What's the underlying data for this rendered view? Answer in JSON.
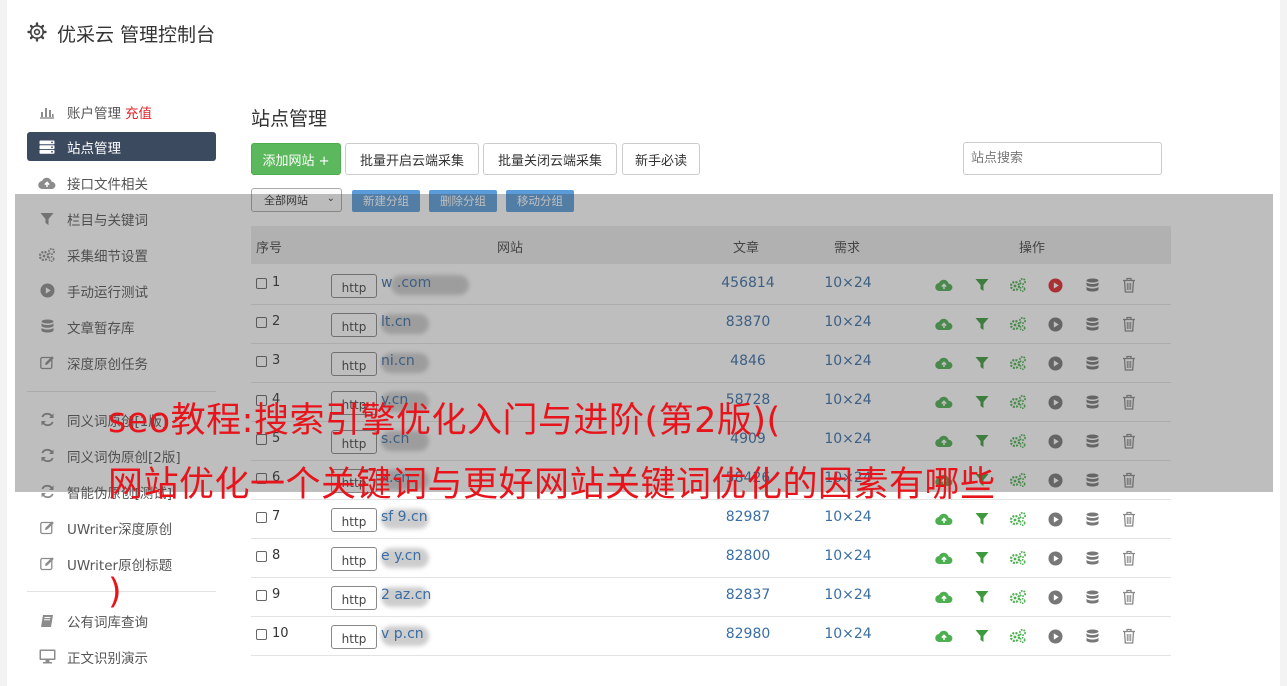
{
  "header": {
    "title": "优采云 管理控制台",
    "icon": "gear-icon"
  },
  "sidebar": {
    "items": [
      {
        "label": "账户管理",
        "extra": "充值",
        "icon": "bar-chart-icon"
      },
      {
        "label": "站点管理",
        "icon": "server-icon",
        "active": true
      },
      {
        "label": "接口文件相关",
        "icon": "cloud-upload-icon"
      },
      {
        "label": "栏目与关键词",
        "icon": "filter-icon"
      },
      {
        "label": "采集细节设置",
        "icon": "cogs-icon"
      },
      {
        "label": "手动运行测试",
        "icon": "play-circle-icon"
      },
      {
        "label": "文章暂存库",
        "icon": "database-icon"
      },
      {
        "label": "深度原创任务",
        "icon": "edit-icon"
      },
      {
        "label": "同义词原创[1版]",
        "icon": "refresh-icon"
      },
      {
        "label": "同义词伪原创[2版]",
        "icon": "refresh-icon"
      },
      {
        "label": "智能伪原创[测试]",
        "icon": "refresh-icon"
      },
      {
        "label": "UWriter深度原创",
        "icon": "edit-icon"
      },
      {
        "label": "UWriter原创标题",
        "icon": "edit-icon"
      },
      {
        "label": "公有词库查询",
        "icon": "book-icon"
      },
      {
        "label": "正文识别演示",
        "icon": "monitor-icon"
      }
    ]
  },
  "main": {
    "title": "站点管理",
    "buttons": {
      "add": "添加网站 +",
      "batch_open": "批量开启云端采集",
      "batch_close": "批量关闭云端采集",
      "guide": "新手必读"
    },
    "search_placeholder": "站点搜索",
    "group_select": "全部网站",
    "group_buttons": {
      "new": "新建分组",
      "delete": "删除分组",
      "move": "移动分组"
    },
    "table": {
      "headers": {
        "index": "序号",
        "site": "网站",
        "articles": "文章",
        "demand": "需求",
        "ops": "操作"
      },
      "http_label": "http",
      "rows": [
        {
          "num": "1",
          "site": "w .com",
          "articles": "456814",
          "demand": "10×24",
          "running": true
        },
        {
          "num": "2",
          "site": "lt.cn",
          "articles": "83870",
          "demand": "10×24",
          "running": false
        },
        {
          "num": "3",
          "site": "ni.cn",
          "articles": "4846",
          "demand": "10×24",
          "running": false
        },
        {
          "num": "4",
          "site": "y.cn",
          "articles": "58728",
          "demand": "10×24",
          "running": false
        },
        {
          "num": "5",
          "site": "s.cn",
          "articles": "4909",
          "demand": "10×24",
          "running": false
        },
        {
          "num": "6",
          "site": "k.cn",
          "articles": "58426",
          "demand": "10×24",
          "running": false
        },
        {
          "num": "7",
          "site": "sf 9.cn",
          "articles": "82987",
          "demand": "10×24",
          "running": false
        },
        {
          "num": "8",
          "site": "e y.cn",
          "articles": "82800",
          "demand": "10×24",
          "running": false
        },
        {
          "num": "9",
          "site": "2 az.cn",
          "articles": "82837",
          "demand": "10×24",
          "running": false
        },
        {
          "num": "10",
          "site": "v p.cn",
          "articles": "82980",
          "demand": "10×24",
          "running": false
        }
      ]
    }
  },
  "overlay": {
    "line1": "seo教程:搜索引擎优化入门与进阶(第2版)(",
    "line2": "网站优化一个关键词与更好网站关键词优化的因素有哪些",
    "line3": ")",
    "color": "#e8141c"
  },
  "colors": {
    "accent_green": "#5cb85c",
    "sidebar_active": "#3c4a60",
    "link": "#3a6ea5",
    "run_red": "#e0262c"
  }
}
